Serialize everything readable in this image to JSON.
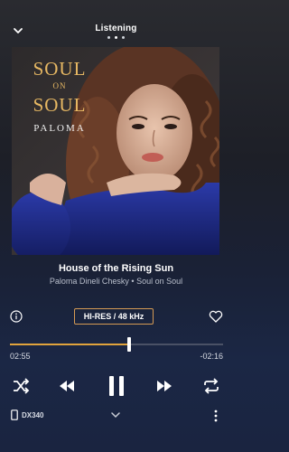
{
  "header": {
    "title": "Listening",
    "pages": 3,
    "active_page": 1
  },
  "album": {
    "line1": "SOUL",
    "line2": "ON",
    "line3": "SOUL",
    "artist": "PALOMA"
  },
  "track": {
    "title": "House of the Rising Sun",
    "subtitle": "Paloma Dineli Chesky • Soul on Soul"
  },
  "quality_badge": "HI-RES / 48 kHz",
  "playback": {
    "elapsed": "02:55",
    "remaining": "-02:16",
    "progress_fraction": 0.56,
    "state": "playing"
  },
  "output": {
    "device": "DX340"
  },
  "colors": {
    "accent": "#e1a33c",
    "badge_border": "#d49a54",
    "title_gold": "#e7b863"
  },
  "icons": {
    "collapse": "chevron-down-icon",
    "info": "info-icon",
    "favorite": "heart-icon",
    "shuffle": "shuffle-icon",
    "previous": "previous-icon",
    "pause": "pause-icon",
    "next": "next-icon",
    "repeat": "repeat-icon",
    "device": "phone-icon",
    "more": "more-vertical-icon"
  }
}
